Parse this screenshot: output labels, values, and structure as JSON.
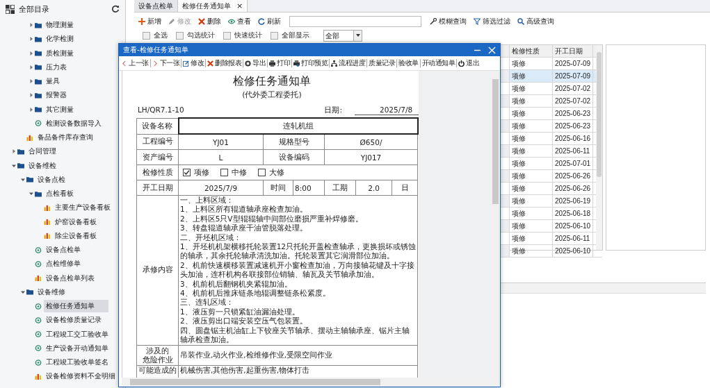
{
  "sidebar": {
    "title": "全部目录",
    "tree": [
      {
        "children": [
          {
            "children": [
              {
                "label": "物理测量",
                "kind": "folder",
                "expanded": false,
                "selected": false
              },
              {
                "label": "化学检测",
                "kind": "folder",
                "expanded": false,
                "selected": false
              },
              {
                "label": "质检测量",
                "kind": "folder",
                "expanded": false,
                "selected": false
              },
              {
                "label": "压力表",
                "kind": "folder",
                "expanded": false,
                "selected": false
              },
              {
                "label": "量具",
                "kind": "folder",
                "expanded": false,
                "selected": false
              },
              {
                "label": "报警器",
                "kind": "folder",
                "expanded": false,
                "selected": false
              },
              {
                "label": "其它测量",
                "kind": "folder",
                "expanded": false,
                "selected": false
              },
              {
                "label": "检测设备数据导入",
                "kind": "form",
                "selected": false
              }
            ]
          },
          {
            "label": "备品备件库存查询",
            "kind": "report",
            "selected": false
          }
        ]
      },
      {
        "label": "合同管理",
        "kind": "folder",
        "expanded": false,
        "selected": false
      },
      {
        "label": "设备维检",
        "kind": "folder",
        "expanded": true,
        "selected": false,
        "children": [
          {
            "label": "设备点检",
            "kind": "folder",
            "expanded": true,
            "selected": false,
            "children": [
              {
                "label": "点检看板",
                "kind": "folder",
                "expanded": true,
                "selected": false,
                "children": [
                  {
                    "label": "主要生产设备看板",
                    "kind": "report",
                    "selected": false
                  },
                  {
                    "label": "炉窑设备看板",
                    "kind": "report",
                    "selected": false
                  },
                  {
                    "label": "除尘设备看板",
                    "kind": "report",
                    "selected": false
                  }
                ]
              },
              {
                "label": "设备点检单",
                "kind": "form",
                "selected": false
              },
              {
                "label": "点检维修单",
                "kind": "form",
                "selected": false
              },
              {
                "label": "设备点检单列表",
                "kind": "report",
                "selected": false
              }
            ]
          },
          {
            "label": "设备维修",
            "kind": "folder",
            "expanded": true,
            "selected": false,
            "children": [
              {
                "label": "检修任务通知单",
                "kind": "form",
                "selected": true
              },
              {
                "label": "设备检修质量记录",
                "kind": "form",
                "selected": false
              },
              {
                "label": "工程竣工交工验收单",
                "kind": "form",
                "selected": false
              },
              {
                "label": "生产设备开动通知单",
                "kind": "form",
                "selected": false
              },
              {
                "label": "工程竣工验收单签名",
                "kind": "form",
                "selected": false
              },
              {
                "label": "设备检修资料不全明细",
                "kind": "report",
                "selected": false
              }
            ]
          }
        ]
      }
    ]
  },
  "tabs": [
    {
      "label": "设备点检单",
      "selected": false
    },
    {
      "label": "检修任务通知单",
      "selected": true,
      "close": "×"
    }
  ],
  "toolbar": [
    {
      "kind": "add",
      "label": "新增",
      "disabled": false
    },
    {
      "kind": "edit",
      "label": "修改",
      "disabled": true
    },
    {
      "kind": "delete",
      "label": "删除",
      "disabled": false
    },
    {
      "kind": "view",
      "label": "查看",
      "disabled": false
    },
    {
      "kind": "refresh",
      "label": "刷新",
      "disabled": false
    }
  ],
  "search_buttons": [
    {
      "kind": "fuzzy",
      "label": "模糊查询"
    },
    {
      "kind": "filter",
      "label": "筛选过滤"
    },
    {
      "kind": "search",
      "label": "高级查询"
    }
  ],
  "options": [
    {
      "label": "全选",
      "checked": false
    },
    {
      "label": "勾选统计",
      "checked": false
    },
    {
      "label": "快速统计",
      "checked": false
    },
    {
      "label": "全部显示",
      "checked": false
    }
  ],
  "scope_select": {
    "value": "全部"
  },
  "table": {
    "columns": [
      "检修性质",
      "开工日期"
    ],
    "rows": [
      {
        "cells": [
          "项修",
          "2025-07-09"
        ],
        "selected": false
      },
      {
        "cells": [
          "项修",
          "2025-07-09"
        ],
        "selected": true
      },
      {
        "cells": [
          "项修",
          "2025-07-02"
        ],
        "selected": false
      },
      {
        "cells": [
          "项修",
          "2025-07-02"
        ],
        "selected": false
      },
      {
        "cells": [
          "项修",
          "2025-06-23"
        ],
        "selected": false
      },
      {
        "cells": [
          "项修",
          "2025-06-23"
        ],
        "selected": false
      },
      {
        "cells": [
          "项修",
          "2025-06-16"
        ],
        "selected": false
      },
      {
        "cells": [
          "项修",
          "2025-06-11"
        ],
        "selected": false
      },
      {
        "cells": [
          "项修",
          "2025-07-01"
        ],
        "selected": false
      },
      {
        "cells": [
          "项修",
          "2025-06-26"
        ],
        "selected": false
      },
      {
        "cells": [
          "项修",
          "2025-06-26"
        ],
        "selected": false
      },
      {
        "cells": [
          "项修",
          "2025-06-19"
        ],
        "selected": false
      },
      {
        "cells": [
          "项修",
          "2025-06-18"
        ],
        "selected": false
      },
      {
        "cells": [
          "项修",
          "2025-06-10"
        ],
        "selected": false
      },
      {
        "cells": [
          "项修",
          "2025-06-11"
        ],
        "selected": false
      },
      {
        "cells": [
          "项修",
          "2025-06-10"
        ],
        "selected": false
      }
    ]
  },
  "dialog": {
    "title": "查看-检修任务通知单",
    "toolbar": [
      {
        "kind": "prev",
        "label": "上一张"
      },
      {
        "kind": "next",
        "label": "下一张"
      },
      {
        "kind": "edit",
        "label": "修改"
      },
      {
        "kind": "delete",
        "label": "删除报表"
      },
      {
        "kind": "export",
        "label": "导出"
      },
      {
        "kind": "print",
        "label": "打印"
      },
      {
        "kind": "preview",
        "label": "打印预览"
      },
      {
        "kind": "flow",
        "label": "流程进度"
      },
      {
        "kind": "text",
        "label": "质量记录"
      },
      {
        "kind": "text",
        "label": "验收单"
      },
      {
        "kind": "text",
        "label": "开动通知单"
      },
      {
        "kind": "exit",
        "label": "退出"
      }
    ],
    "form": {
      "title": "检修任务通知单",
      "subtitle": "(代外委工程委托)",
      "code": "LH/QR7.1-10",
      "date_label": "日期:",
      "date": "2025/7/8",
      "equipment_name": {
        "label": "设备名称",
        "value": "连轧机组"
      },
      "project_no": {
        "label": "工程编号",
        "value": "YJ01"
      },
      "spec": {
        "label": "规格型号",
        "value": "Ø650/"
      },
      "asset_no": {
        "label": "资产编号",
        "value": "L"
      },
      "equipment_code": {
        "label": "设备编码",
        "value": "YJ017"
      },
      "repair_type": {
        "label": "检修性质",
        "options": [
          {
            "label": "项修",
            "checked": true
          },
          {
            "label": "中修",
            "checked": false
          },
          {
            "label": "大修",
            "checked": false
          }
        ]
      },
      "start": {
        "label": "开工日期",
        "value": "2025/7/9",
        "time_label": "时间",
        "time": "8:00",
        "duration_label": "工期",
        "duration": "2.0",
        "unit": "日"
      },
      "scope": {
        "label": "承修内容",
        "lines": [
          "一、上料区域：",
          "1、上料区所有辊道轴承座检查加油。",
          "2、上料区5只V型辊辊轴中间部位磨损严重补焊修磨。",
          "3、转盘辊道轴承座干油管脱落处理。",
          "二、开坯机区域：",
          "1、开坯机机架横移托轮装置12只托轮开盖检查轴承，更换损坏或锈蚀的轴承，其余托轮轴承清洗加油。托轮装置其它润滑部位加油。",
          "2、机前快速横移装置减速机开小窗检查加油，万向接轴花键及十字接头加油，连杆机构各联接部位销轴、轴瓦及关节轴承加油。",
          "3、机前机后翻钢机夹紧辊加油。",
          "4、机前机后推床链条地辊调整链条松紧度。",
          "三、连轧区域：",
          "1、液压剪一只锁紧缸油漏油处理。",
          "2、液压剪出口端安装空压气包装置。",
          "四、圆盘锯主机油缸上下铰座关节轴承、摆动主轴轴承座、锯片主轴轴承检查加油。"
        ]
      },
      "hazards": {
        "label": [
          "涉及的",
          "危险作业"
        ],
        "value": "吊装作业,动火作业,检维修作业,受限空间作业"
      },
      "injuries": {
        "label": "可能造成的",
        "value": "机械伤害,其他伤害,起重伤害,物体打击"
      }
    }
  }
}
